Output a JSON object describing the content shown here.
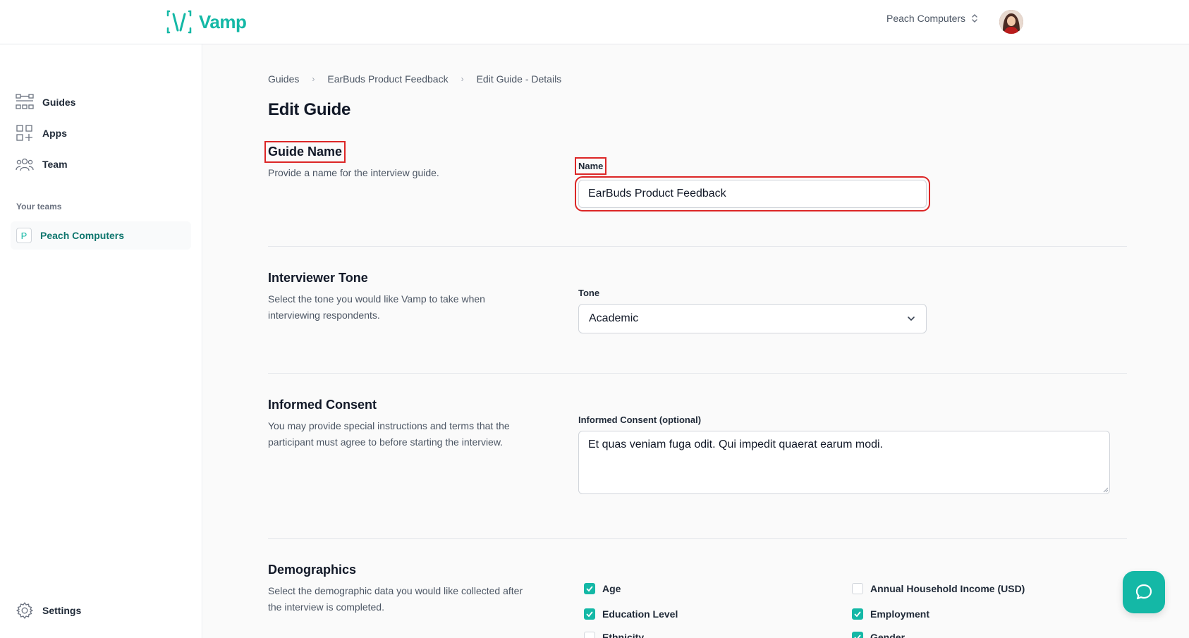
{
  "app": {
    "brand": "Vamp",
    "team_switcher": "Peach Computers",
    "accent": "#14b8a6",
    "highlight": "#dc2626"
  },
  "sidebar": {
    "items": [
      {
        "label": "Guides",
        "icon": "guides-icon"
      },
      {
        "label": "Apps",
        "icon": "apps-icon"
      },
      {
        "label": "Team",
        "icon": "team-icon"
      }
    ],
    "teams_heading": "Your teams",
    "team": {
      "badge": "P",
      "name": "Peach Computers"
    },
    "settings_label": "Settings"
  },
  "breadcrumb": [
    "Guides",
    "EarBuds Product Feedback",
    "Edit Guide - Details"
  ],
  "page_title": "Edit Guide",
  "sections": {
    "guide_name": {
      "title": "Guide Name",
      "desc": "Provide a name for the interview guide.",
      "field_label": "Name",
      "value": "EarBuds Product Feedback"
    },
    "tone": {
      "title": "Interviewer Tone",
      "desc": "Select the tone you would like Vamp to take when interviewing respondents.",
      "field_label": "Tone",
      "value": "Academic"
    },
    "consent": {
      "title": "Informed Consent",
      "desc": "You may provide special instructions and terms that the participant must agree to before starting the interview.",
      "field_label": "Informed Consent (optional)",
      "value": "Et quas veniam fuga odit. Qui impedit quaerat earum modi."
    },
    "demographics": {
      "title": "Demographics",
      "desc": "Select the demographic data you would like collected after the interview is completed.",
      "options": [
        {
          "label": "Age",
          "checked": true
        },
        {
          "label": "Annual Household Income (USD)",
          "checked": false
        },
        {
          "label": "Education Level",
          "checked": true
        },
        {
          "label": "Employment",
          "checked": true
        },
        {
          "label": "Ethnicity",
          "checked": false
        },
        {
          "label": "Gender",
          "checked": true
        }
      ]
    }
  }
}
